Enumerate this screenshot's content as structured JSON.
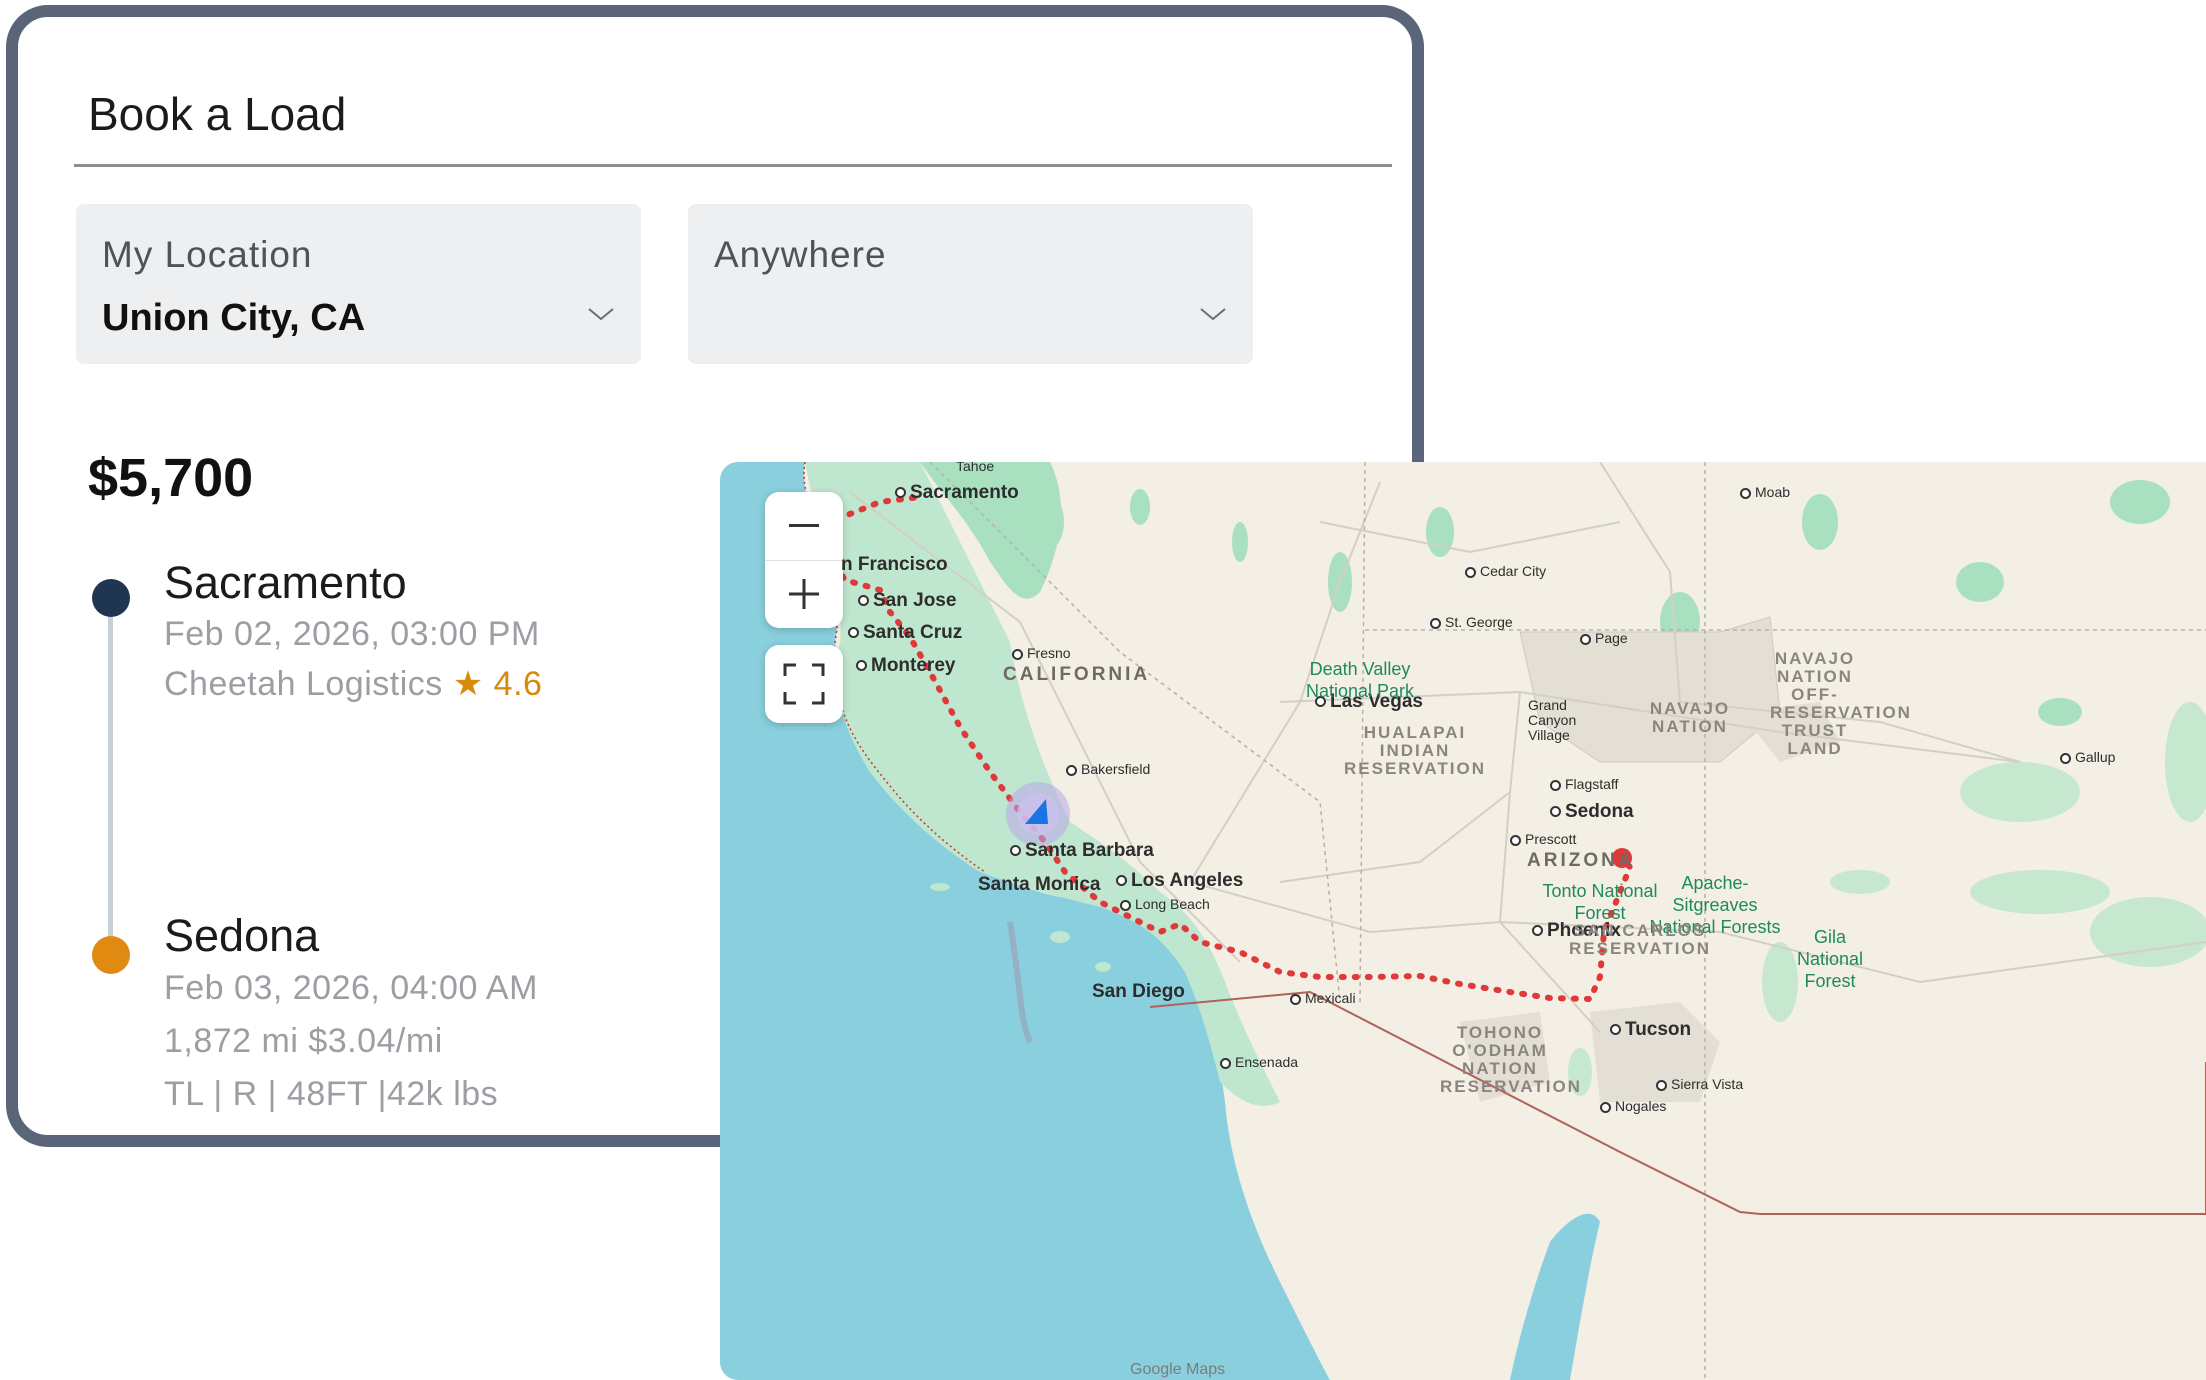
{
  "card": {
    "title": "Book a Load",
    "origin": {
      "label": "My Location",
      "value": "Union City, CA"
    },
    "destination": {
      "label": "Anywhere",
      "value": ""
    },
    "price": "$5,700",
    "stops": [
      {
        "name": "Sacramento",
        "datetime": "Feb 02, 2026, 03:00 PM",
        "carrier": "Cheetah Logistics",
        "rating": "4.6",
        "dot_color": "#1f3552"
      },
      {
        "name": "Sedona",
        "datetime": "Feb 03, 2026, 04:00 AM",
        "distance_rate": "1,872 mi $3.04/mi",
        "equipment": "TL | R | 48FT |42k lbs",
        "dot_color": "#e08a12"
      }
    ]
  },
  "map": {
    "controls": {
      "zoom_out": "−",
      "zoom_in": "+",
      "fullscreen": "fullscreen"
    },
    "places": {
      "sacramento": "Sacramento",
      "tahoe": "Tahoe",
      "san_francisco": "n Francisco",
      "san_jose": "San Jose",
      "santa_cruz": "Santa Cruz",
      "monterey": "Monterey",
      "fresno": "Fresno",
      "bakersfield": "Bakersfield",
      "santa_barbara": "Santa Barbara",
      "santa_monica": "Santa Monica",
      "los_angeles": "Los Angeles",
      "long_beach": "Long Beach",
      "san_diego": "San Diego",
      "mexicali": "Mexicali",
      "ensenada": "Ensenada",
      "las_vegas": "Las Vegas",
      "cedar_city": "Cedar City",
      "st_george": "St. George",
      "page": "Page",
      "moab": "Moab",
      "grand_canyon": "Grand Canyon Village",
      "flagstaff": "Flagstaff",
      "sedona": "Sedona",
      "prescott": "Prescott",
      "phoenix": "Phoenix",
      "tucson": "Tucson",
      "sierra_vista": "Sierra Vista",
      "nogales": "Nogales",
      "gallup": "Gallup"
    },
    "states": {
      "california": "CALIFORNIA",
      "arizona": "ARIZONA"
    },
    "parks": {
      "death_valley": "Death Valley National Park",
      "tonto": "Tonto National Forest",
      "apache": "Apache-Sitgreaves National Forests",
      "gila": "Gila National Forest"
    },
    "regions": {
      "hualapai": "HUALAPAI INDIAN RESERVATION",
      "navajo_nation": "NAVAJO NATION",
      "navajo_trust": "NAVAJO NATION OFF-RESERVATION TRUST LAND",
      "san_carlos": "SAN CARLOS RESERVATION",
      "tohono": "TOHONO O'ODHAM NATION RESERVATION"
    },
    "attribution": "Google Maps",
    "route_color": "#e0393a"
  }
}
